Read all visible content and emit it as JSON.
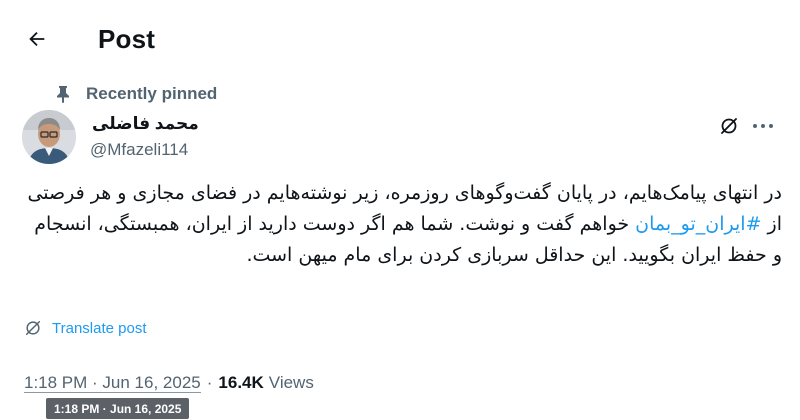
{
  "header": {
    "title": "Post",
    "back_icon": "arrow-left-icon"
  },
  "pinned": {
    "label": "Recently pinned",
    "icon": "pin-icon"
  },
  "author": {
    "name": "محمد فاضلی",
    "handle": "@Mfazeli114"
  },
  "actions": {
    "grok_icon": "grok-slash-icon",
    "more_icon": "more-dots-icon"
  },
  "tweet": {
    "text_before": "در انتهای پیامک‌هایم، در پایان گفت‌وگوهای روزمره، زیر نوشته‌هایم در فضای مجازی و هر فرصتی از ",
    "hashtag": "#ایران_تو_بمان",
    "text_after": " خواهم گفت و نوشت. شما هم اگر دوست دارید از ایران، همبستگی، انسجام و حفظ ایران بگویید. این حداقل سربازی کردن برای مام میهن است."
  },
  "translate": {
    "label": "Translate post",
    "icon": "translate-icon"
  },
  "meta": {
    "time": "1:18 PM · Jun 16, 2025",
    "separator": "·",
    "views_count": "16.4K",
    "views_label": "Views"
  },
  "tooltip": {
    "text": "1:18 PM · Jun 16, 2025"
  },
  "colors": {
    "accent": "#1d9bf0",
    "secondary_text": "#536471",
    "primary_text": "#0f1419"
  }
}
